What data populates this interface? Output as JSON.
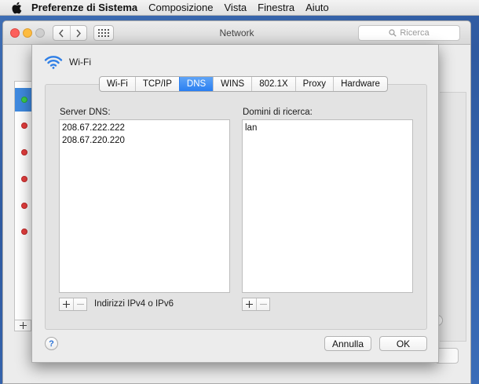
{
  "menubar": {
    "app_name": "Preferenze di Sistema",
    "items": [
      "Composizione",
      "Vista",
      "Finestra",
      "Aiuto"
    ]
  },
  "window": {
    "title": "Network",
    "search_placeholder": "Ricerca"
  },
  "sheet": {
    "interface_name": "Wi-Fi",
    "tabs": [
      {
        "label": "Wi-Fi",
        "active": false
      },
      {
        "label": "TCP/IP",
        "active": false
      },
      {
        "label": "DNS",
        "active": true
      },
      {
        "label": "WINS",
        "active": false
      },
      {
        "label": "802.1X",
        "active": false
      },
      {
        "label": "Proxy",
        "active": false
      },
      {
        "label": "Hardware",
        "active": false
      }
    ],
    "dns_servers": {
      "label": "Server DNS:",
      "entries": [
        "208.67.222.222",
        "208.67.220.220"
      ],
      "hint": "Indirizzi IPv4 o IPv6"
    },
    "search_domains": {
      "label": "Domini di ricerca:",
      "entries": [
        "lan"
      ]
    },
    "buttons": {
      "help": "?",
      "cancel": "Annulla",
      "ok": "OK"
    }
  },
  "colors": {
    "accent": "#2a7ff1",
    "status_connected": "#3ccf4e",
    "status_disconnected": "#e43e3e"
  }
}
